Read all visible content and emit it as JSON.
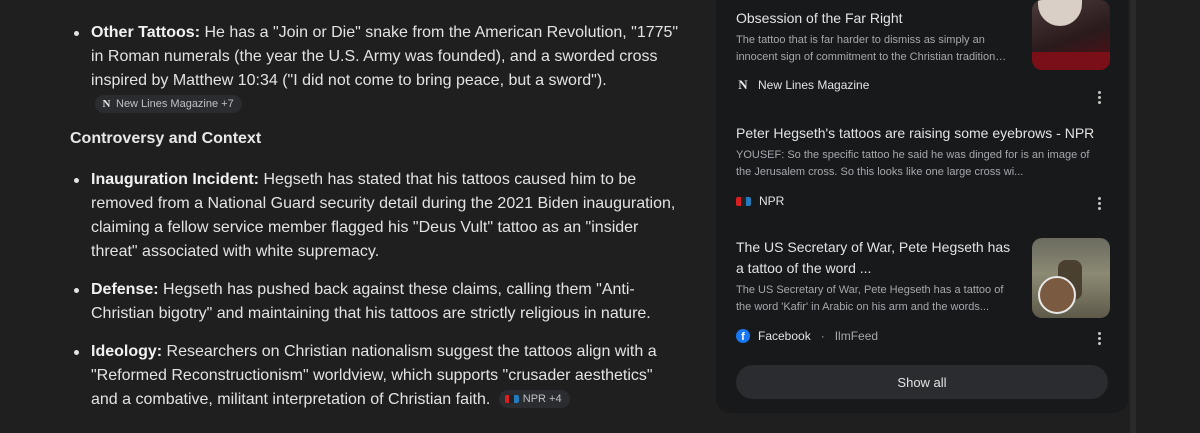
{
  "main": {
    "other_tattoos": {
      "label": "Other Tattoos:",
      "text": " He has a \"Join or Die\" snake from the American Revolution, \"1775\" in Roman numerals (the year the U.S. Army was founded), and a sworded cross inspired by Matthew 10:34 (\"I did not come to bring peace, but a sword\").",
      "chip_label": "New Lines Magazine +7"
    },
    "section_heading": "Controversy and Context",
    "items": [
      {
        "label": "Inauguration Incident:",
        "text": " Hegseth has stated that his tattoos caused him to be removed from a National Guard security detail during the 2021 Biden inauguration, claiming a fellow service member flagged his \"Deus Vult\" tattoo as an \"insider threat\" associated with white supremacy."
      },
      {
        "label": "Defense:",
        "text": " Hegseth has pushed back against these claims, calling them \"Anti-Christian bigotry\" and maintaining that his tattoos are strictly religious in nature."
      },
      {
        "label": "Ideology:",
        "text": " Researchers on Christian nationalism suggest the tattoos align with a \"Reformed Reconstructionism\" worldview, which supports \"crusader aesthetics\" and a combative, militant interpretation of Christian faith.",
        "chip_label": "NPR +4"
      }
    ]
  },
  "sources": [
    {
      "title": "Obsession of the Far Right",
      "snippet": "The tattoo that is far harder to dismiss as simply an innocent sign of commitment to the Christian tradition…",
      "publisher": "New Lines Magazine",
      "logo_icon": "n-logo-icon"
    },
    {
      "title": "Peter Hegseth's tattoos are raising some eyebrows - NPR",
      "snippet": "YOUSEF: So the specific tattoo he said he was dinged for is an image of the Jerusalem cross. So this looks like one large cross wi...",
      "publisher": "NPR",
      "logo_icon": "npr-logo-icon"
    },
    {
      "title": "The US Secretary of War, Pete Hegseth has a tattoo of the word ...",
      "snippet": "The US Secretary of War, Pete Hegseth has a tattoo of the word 'Kafir' in Arabic on his arm and the words...",
      "publisher": "Facebook",
      "sub": "IlmFeed",
      "logo_icon": "facebook-logo-icon"
    }
  ],
  "show_all_label": "Show all",
  "colors": {
    "background": "#1f1f1f",
    "panel": "#18191b",
    "text": "#e3e3e3",
    "muted": "#a5a8ac",
    "facebook": "#1877f2"
  }
}
